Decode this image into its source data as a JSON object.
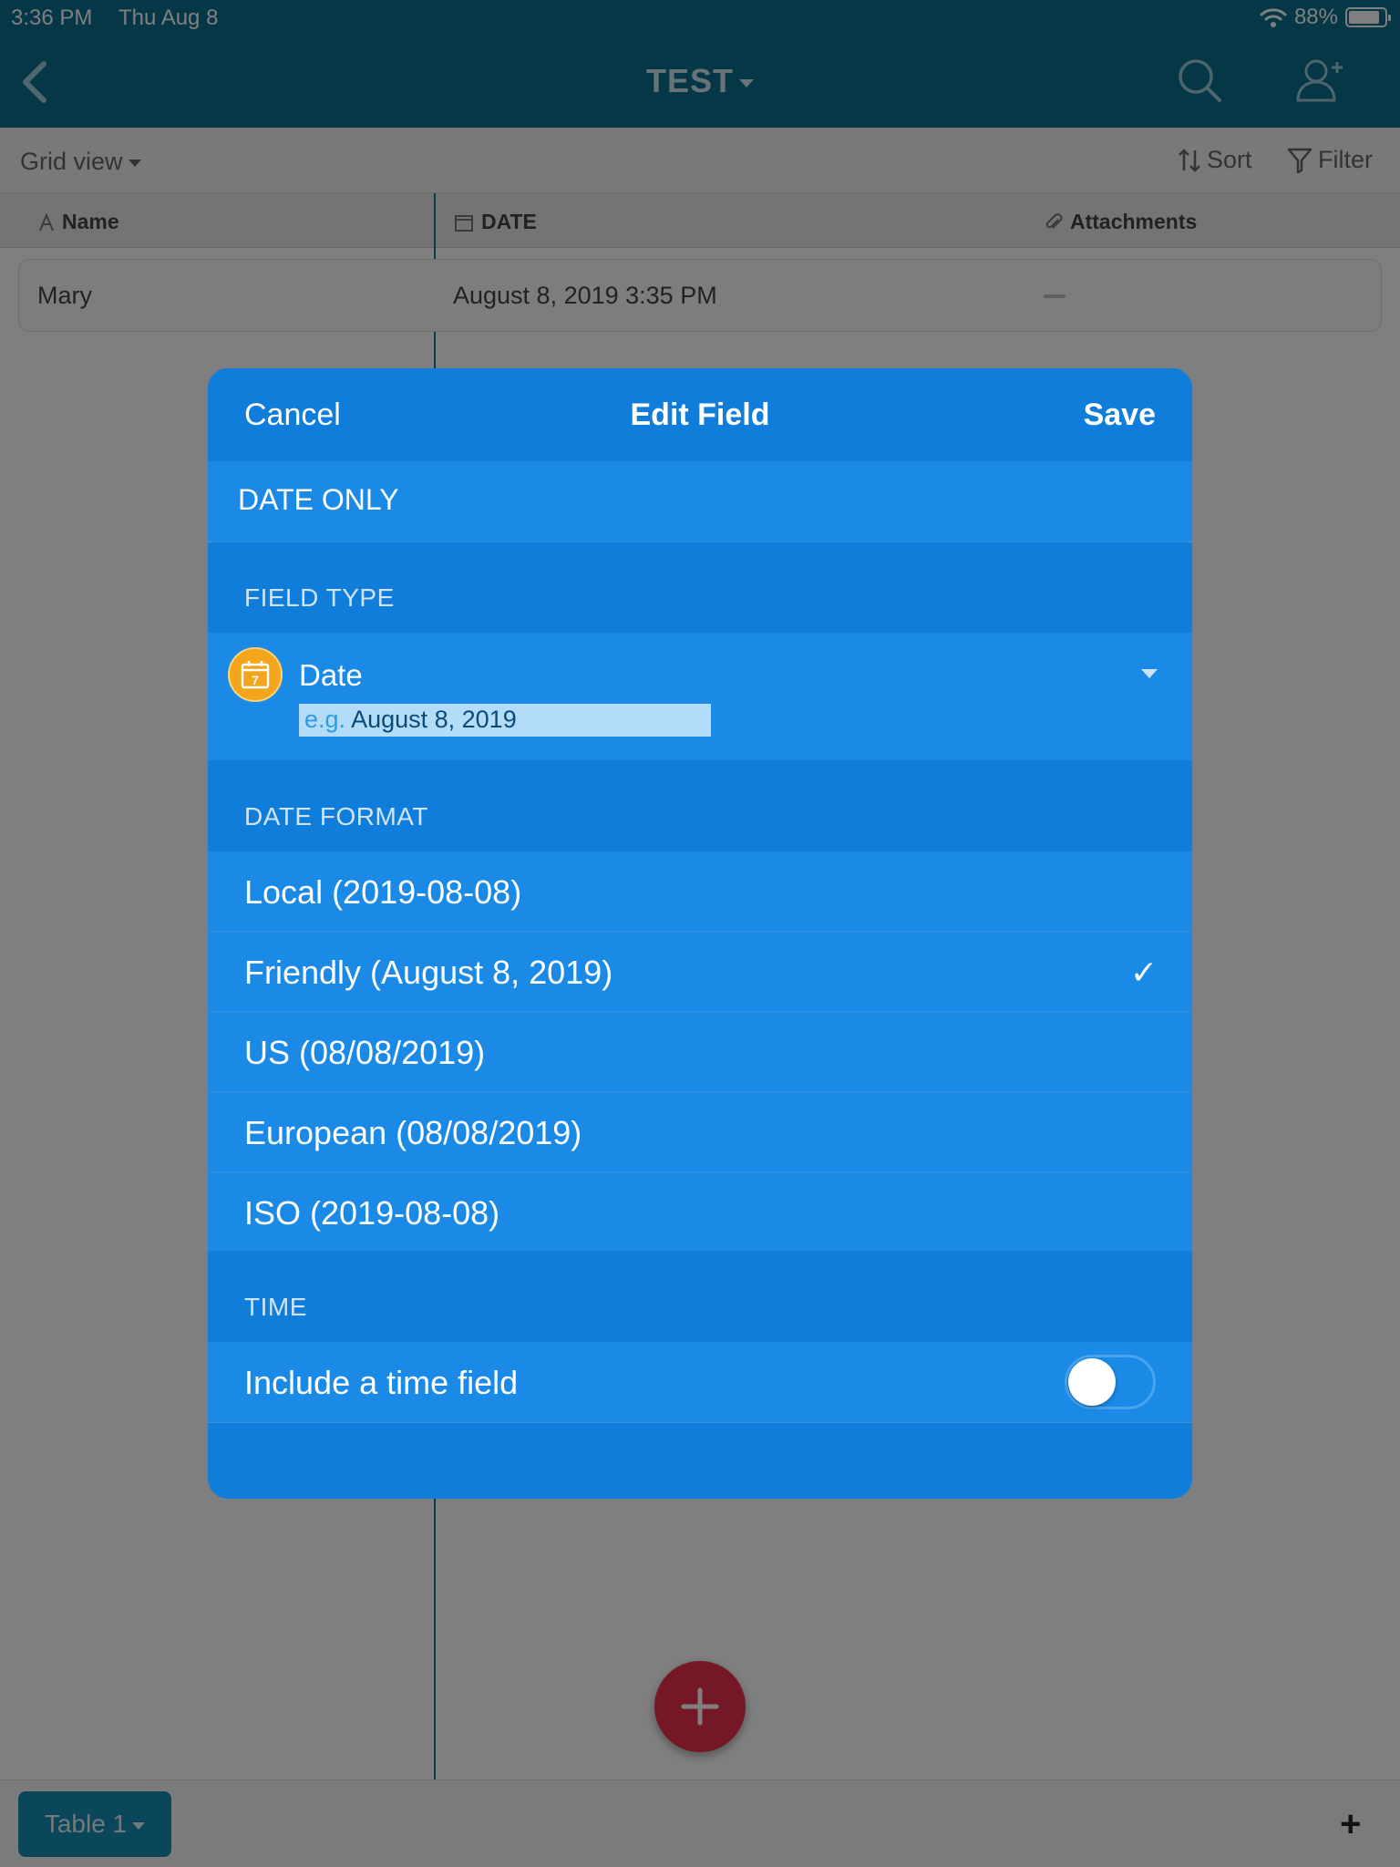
{
  "status": {
    "time": "3:36 PM",
    "date": "Thu Aug 8",
    "battery": "88%",
    "battery_level": 0.88
  },
  "nav": {
    "title": "TEST"
  },
  "toolbar": {
    "view": "Grid view",
    "sort": "Sort",
    "filter": "Filter"
  },
  "grid": {
    "columns": [
      "Name",
      "DATE",
      "Attachments"
    ],
    "rows": [
      {
        "name": "Mary",
        "date": "August 8, 2019 3:35 PM"
      }
    ]
  },
  "bottom": {
    "table_tab": "Table 1",
    "add": "+"
  },
  "modal": {
    "cancel": "Cancel",
    "title": "Edit Field",
    "save": "Save",
    "field_name": "DATE ONLY",
    "field_type_label": "FIELD TYPE",
    "field_type": "Date",
    "example_prefix": "e.g.",
    "example_value": "August 8, 2019",
    "calendar_day": "7",
    "date_format_label": "DATE FORMAT",
    "date_formats": [
      {
        "label": "Local (2019-08-08)",
        "selected": false
      },
      {
        "label": "Friendly (August 8, 2019)",
        "selected": true
      },
      {
        "label": "US (08/08/2019)",
        "selected": false
      },
      {
        "label": "European (08/08/2019)",
        "selected": false
      },
      {
        "label": "ISO (2019-08-08)",
        "selected": false
      }
    ],
    "time_label": "TIME",
    "include_time": "Include a time field",
    "include_time_on": false,
    "check_glyph": "✓"
  },
  "colors": {
    "brand": "#0d6f8d",
    "modal": "#0f7dd9",
    "row": "#1a8ae6",
    "fab": "#e8304d",
    "icon": "#f3a61b"
  }
}
